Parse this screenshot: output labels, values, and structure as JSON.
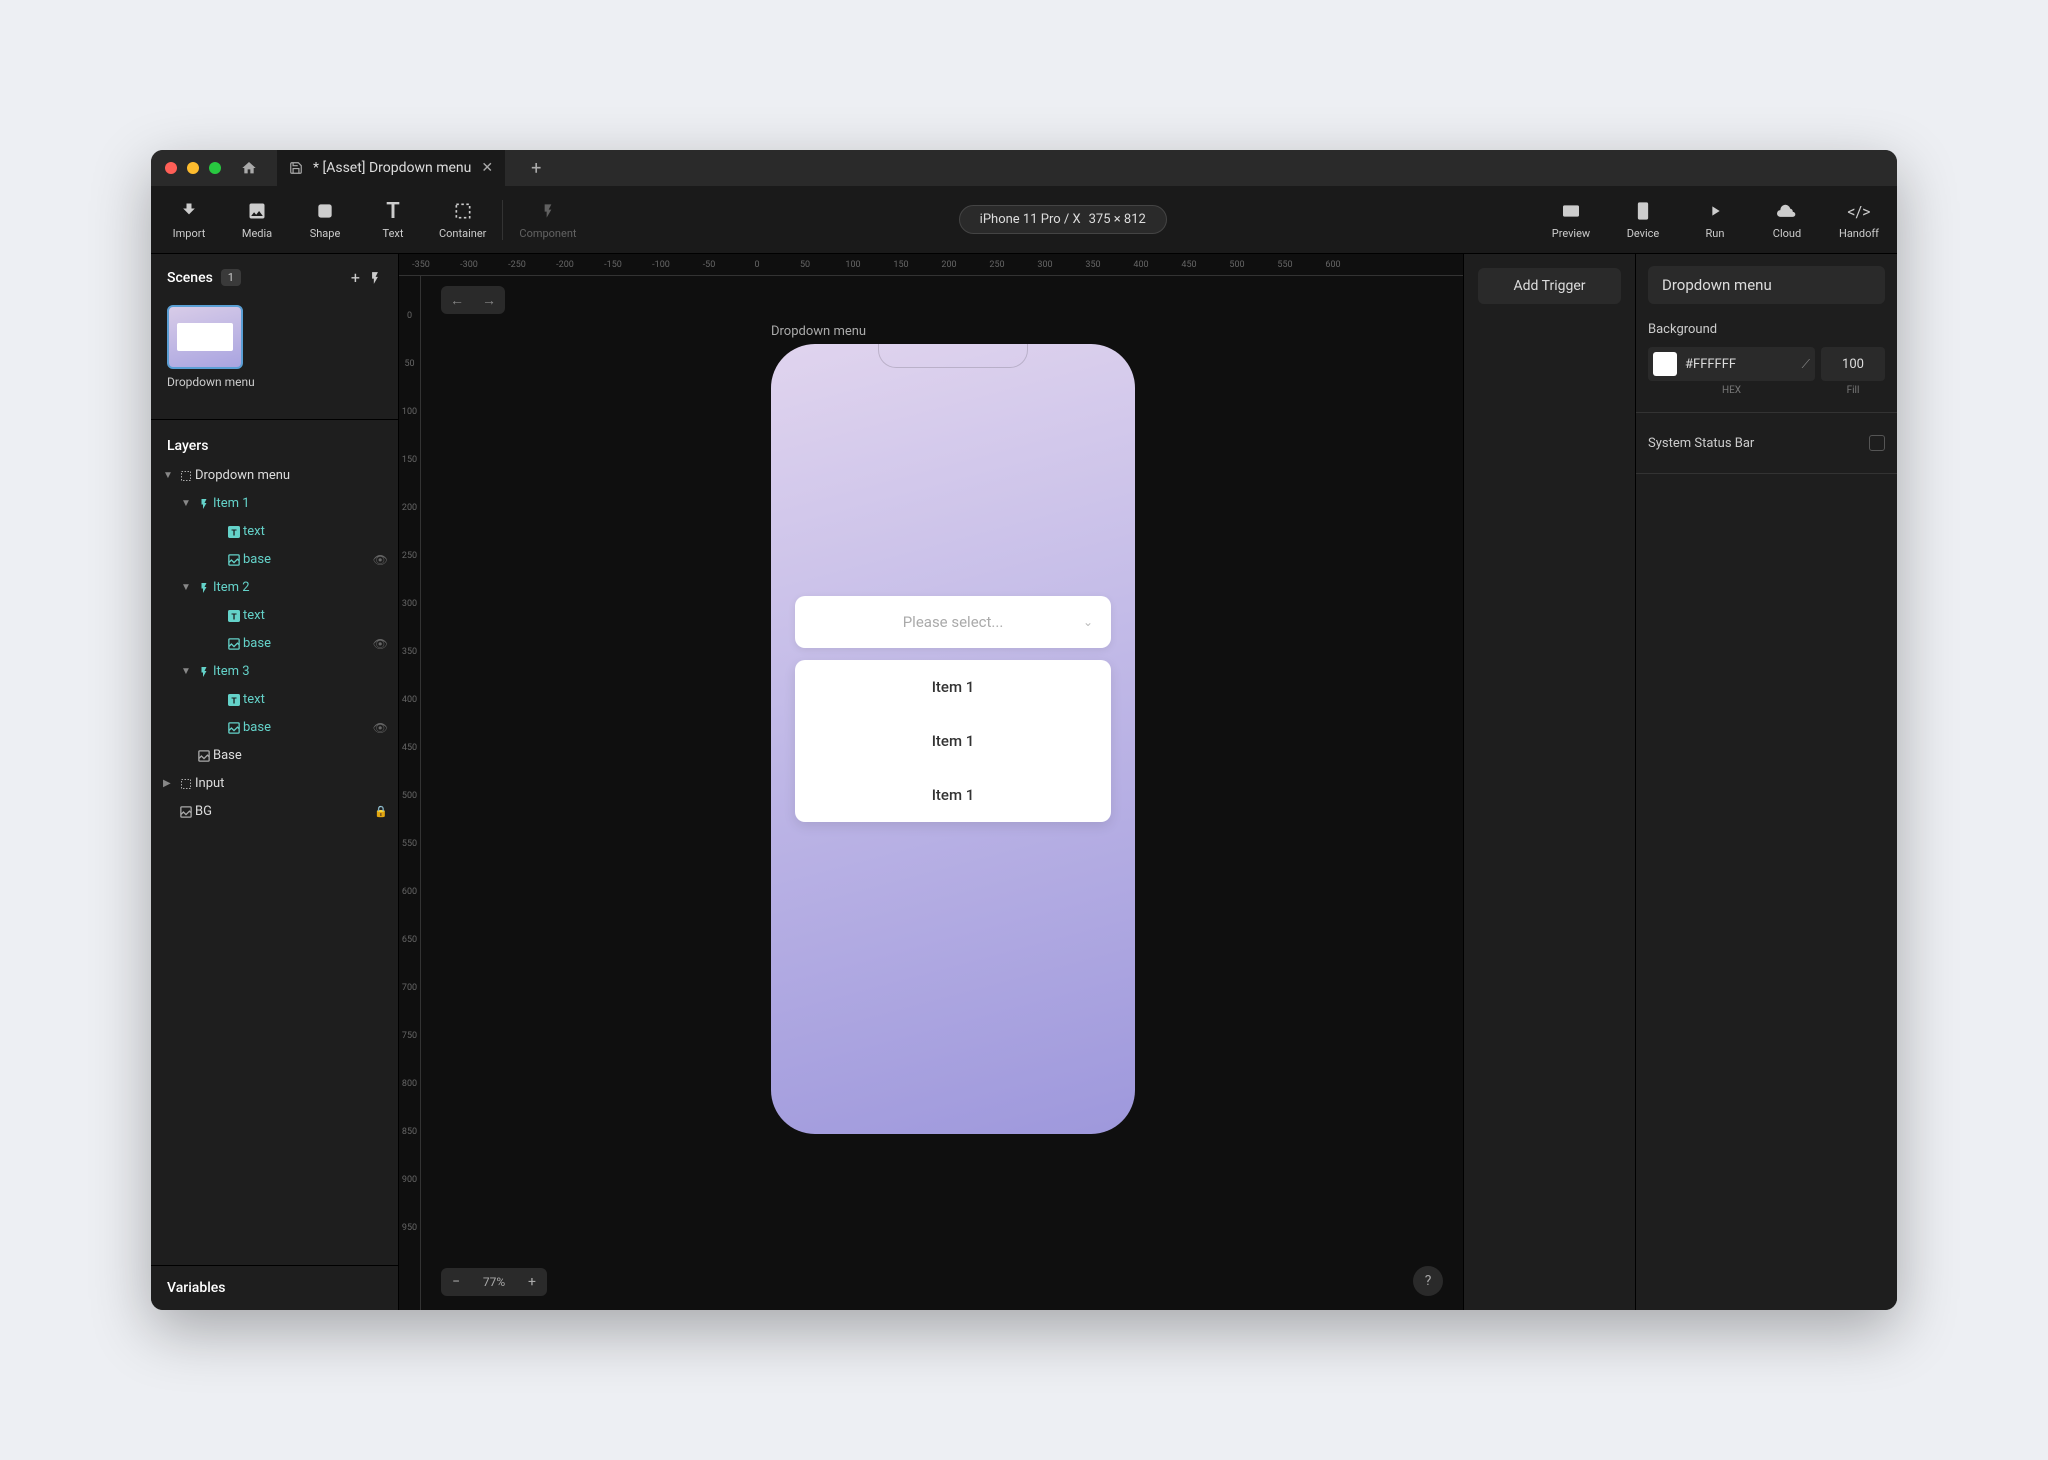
{
  "titlebar": {
    "tab_title": "* [Asset] Dropdown menu"
  },
  "toolbar": {
    "import": "Import",
    "media": "Media",
    "shape": "Shape",
    "text": "Text",
    "container": "Container",
    "component": "Component",
    "preview": "Preview",
    "device": "Device",
    "run": "Run",
    "cloud": "Cloud",
    "handoff": "Handoff"
  },
  "device_chip": {
    "name": "iPhone 11 Pro / X",
    "dims": "375 × 812"
  },
  "scenes": {
    "title": "Scenes",
    "count": "1",
    "thumb_label": "Dropdown menu"
  },
  "layers": {
    "title": "Layers",
    "root": "Dropdown menu",
    "item1": "Item 1",
    "item2": "Item 2",
    "item3": "Item 3",
    "text": "text",
    "base_lc": "base",
    "base": "Base",
    "input": "Input",
    "bg": "BG"
  },
  "variables": {
    "title": "Variables"
  },
  "ruler_h": [
    "-350",
    "-300",
    "-250",
    "-200",
    "-150",
    "-100",
    "-50",
    "0",
    "50",
    "100",
    "150",
    "200",
    "250",
    "300",
    "350",
    "400",
    "450",
    "500",
    "550",
    "600"
  ],
  "ruler_v": [
    "0",
    "50",
    "100",
    "150",
    "200",
    "250",
    "300",
    "350",
    "400",
    "450",
    "500",
    "550",
    "600",
    "650",
    "700",
    "750",
    "800",
    "850",
    "900",
    "950"
  ],
  "canvas": {
    "artboard_label": "Dropdown menu",
    "placeholder": "Please select...",
    "items": [
      "Item 1",
      "Item 1",
      "Item 1"
    ],
    "zoom": "77%"
  },
  "mid_panel": {
    "add_trigger": "Add Trigger"
  },
  "inspector": {
    "selection": "Dropdown menu",
    "background_label": "Background",
    "hex": "#FFFFFF",
    "fill": "100",
    "hex_label": "HEX",
    "fill_label": "Fill",
    "status_bar": "System Status Bar"
  }
}
